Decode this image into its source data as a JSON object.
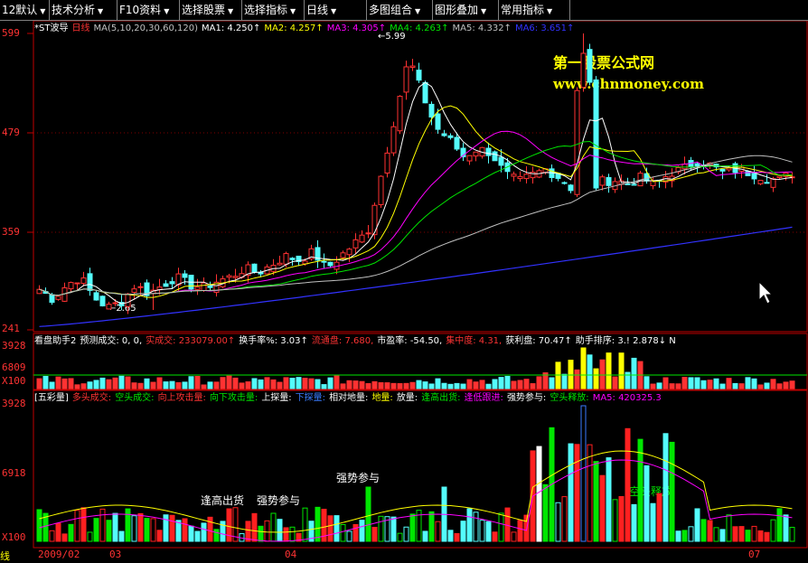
{
  "toolbar": {
    "items": [
      {
        "label": "12默认"
      },
      {
        "label": "技术分析"
      },
      {
        "label": "F10资料"
      },
      {
        "label": "选择股票"
      },
      {
        "label": "选择指标"
      },
      {
        "label": "日线"
      },
      {
        "label": "多图组合"
      },
      {
        "label": "图形叠加"
      },
      {
        "label": "常用指标"
      }
    ]
  },
  "watermark": {
    "line1": "第一股票公式网",
    "line2": "www.chnmoney.com"
  },
  "main_header": {
    "stock": "*ST波导",
    "period": "日线",
    "ma_params": "MA(5,10,20,30,60,120)",
    "ma1": "MA1: 4.250↑",
    "ma2": "MA2: 4.257↑",
    "ma3": "MA3: 4.305↑",
    "ma4": "MA4: 4.263↑",
    "ma5": "MA5: 4.332↑",
    "ma6": "MA6: 3.651↑"
  },
  "main_axis": {
    "labels": [
      "599",
      "479",
      "359",
      "241"
    ]
  },
  "annotations": {
    "high": "5.99",
    "low": "2.65"
  },
  "vol_header": {
    "title": "看盘助手2",
    "items": [
      "预测成交: 0, 0,",
      "实成交: 233079.00↑",
      "换手率%: 3.03↑",
      "流通盘: 7.680,",
      "市盈率: -54.50,",
      "集中度: 4.31,",
      "获利盘: 70.47↑",
      "助手排序: 3.! 2.878↓ N"
    ]
  },
  "vol_axis": {
    "labels": [
      "3928",
      "6809",
      "X100"
    ]
  },
  "wc_header": {
    "title": "[五彩量]",
    "items": [
      "多头成交:",
      "空头成交:",
      "向上攻击量:",
      "向下攻击量:",
      "上探量:",
      "下探量:",
      "相对地量:",
      "地量:",
      "放量:",
      "逢高出货:",
      "逢低跟进:",
      "强势参与:",
      "空头释放:",
      "MA5: 420325.3"
    ]
  },
  "wc_axis": {
    "labels": [
      "3928",
      "6918",
      "X100"
    ]
  },
  "wc_annotations": [
    "逢高出货",
    "强势参与",
    "强势参与",
    "空头释放"
  ],
  "x_axis": {
    "labels": [
      "2009/02",
      "03",
      "04",
      "07"
    ],
    "corner": "线"
  },
  "colors": {
    "up": "#ff3232",
    "down": "#54fcfc",
    "ma1": "#ffffff",
    "ma2": "#ffff00",
    "ma3": "#ff00ff",
    "ma4": "#00e600",
    "ma5": "#c0c0c0",
    "ma6": "#3232ff"
  },
  "chart_data": {
    "type": "candlestick",
    "y_unit": "price (CNY)",
    "ylim": [
      2.41,
      5.99
    ],
    "high": 5.99,
    "low": 2.65,
    "x_range": [
      "2009/02",
      "2009/07"
    ],
    "close_path": [
      2.9,
      2.78,
      2.95,
      3.05,
      2.8,
      2.68,
      2.75,
      2.95,
      2.85,
      2.95,
      3.05,
      2.95,
      2.92,
      3.0,
      3.05,
      3.15,
      3.1,
      3.2,
      3.3,
      3.25,
      3.35,
      3.15,
      3.3,
      3.45,
      3.6,
      4.3,
      5.0,
      5.7,
      5.25,
      4.85,
      4.7,
      4.5,
      4.6,
      4.55,
      4.3,
      4.2,
      4.28,
      4.35,
      4.25,
      4.1,
      4.05,
      4.2,
      4.22,
      4.18,
      4.25,
      4.15,
      4.3,
      4.35,
      4.45,
      4.4,
      4.3,
      4.35,
      4.3,
      4.25,
      4.22,
      4.3
    ],
    "ma_last": {
      "MA1": 4.25,
      "MA2": 4.257,
      "MA3": 4.305,
      "MA4": 4.263,
      "MA5": 4.332,
      "MA6": 3.651
    }
  }
}
